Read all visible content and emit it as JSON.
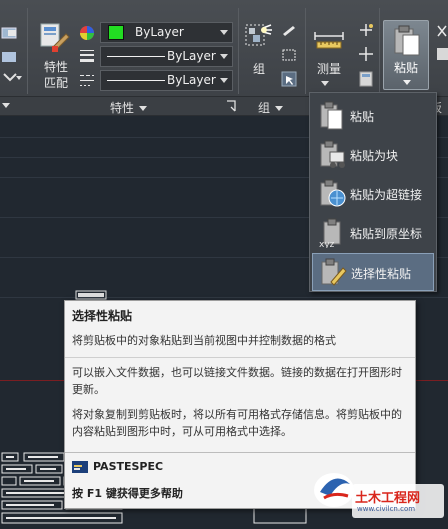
{
  "properties_panel": {
    "match_label_line1": "特性",
    "match_label_line2": "匹配",
    "color_combo": "ByLayer",
    "lineweight_combo": "ByLayer",
    "linetype_combo": "ByLayer",
    "title": "特性",
    "color_swatch": "#22dd22"
  },
  "group_panel": {
    "group_label": "组",
    "title": "组"
  },
  "utilities_panel": {
    "measure_label": "测量"
  },
  "clipboard_panel": {
    "paste_label": "粘贴",
    "title_partial": "板"
  },
  "paste_menu": {
    "items": [
      {
        "label": "粘贴",
        "icon": "paste-icon"
      },
      {
        "label": "粘贴为块",
        "icon": "paste-as-block-icon"
      },
      {
        "label": "粘贴为超链接",
        "icon": "paste-as-hyperlink-icon"
      },
      {
        "label": "粘贴到原坐标",
        "icon": "paste-to-original-coordinates-icon"
      },
      {
        "label": "选择性粘贴",
        "icon": "paste-special-icon"
      }
    ],
    "active_index": 4
  },
  "tooltip": {
    "title": "选择性粘贴",
    "description": "将剪贴板中的对象粘贴到当前视图中并控制数据的格式",
    "para1": "可以嵌入文件数据，也可以链接文件数据。链接的数据在打开图形时更新。",
    "para2": "将对象复制到剪贴板时，将以所有可用格式存储信息。将剪贴板中的内容粘贴到图形中时，可从可用格式中选择。",
    "command": "PASTESPEC",
    "help": "按 F1 键获得更多帮助"
  },
  "watermark": {
    "text": "土木工程网",
    "sub": "www.civilcn.com"
  }
}
